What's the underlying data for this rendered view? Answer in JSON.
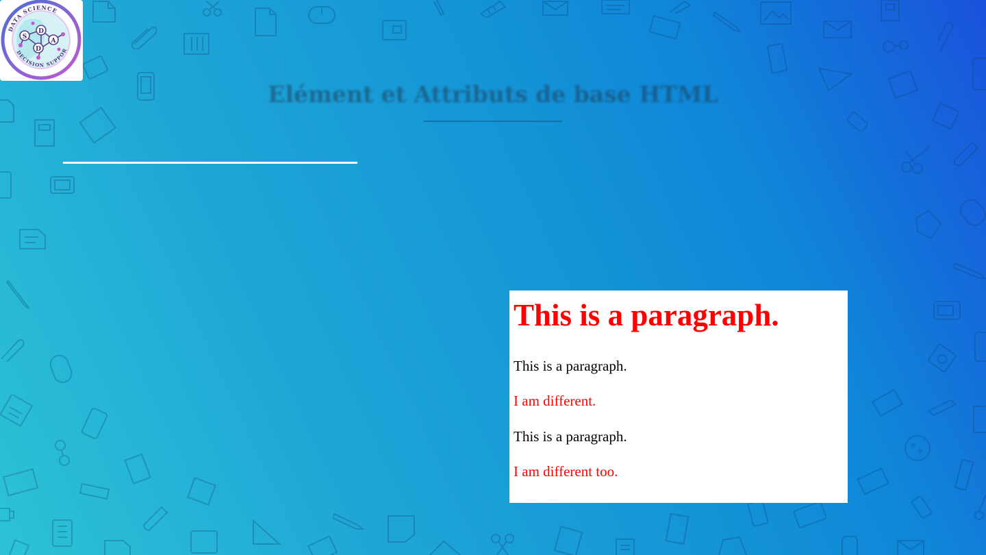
{
  "slide": {
    "title": "Elément et Attributs de base HTML"
  },
  "logo": {
    "alt_text": "DATA SCIENCE DECISION SUPPORT",
    "letters": [
      "S",
      "D",
      "A",
      "D"
    ]
  },
  "output": {
    "heading": "This is a paragraph.",
    "heading_color": "#ff0000",
    "paragraphs": [
      {
        "text": "This is a paragraph.",
        "color": "#000000"
      },
      {
        "text": "I am different.",
        "color": "#ff0000"
      },
      {
        "text": "This is a paragraph.",
        "color": "#000000"
      },
      {
        "text": "I am different too.",
        "color": "#ff0000"
      }
    ]
  },
  "colors": {
    "background_start": "#2cc3d6",
    "background_end": "#1a52dc",
    "accent_white_rule": "#ffffff"
  }
}
